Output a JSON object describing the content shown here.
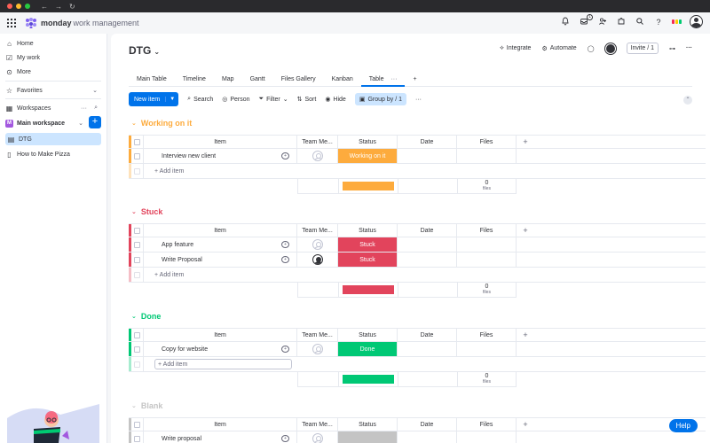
{
  "app": {
    "brand": "monday",
    "brand_sub": "work management",
    "notif_badge": "1"
  },
  "sidebar": {
    "home": "Home",
    "my_work": "My work",
    "more": "More",
    "favorites": "Favorites",
    "workspaces": "Workspaces",
    "workspace_badge": "M",
    "workspace_name": "Main workspace",
    "boards": [
      "DTG",
      "How to Make Pizza"
    ]
  },
  "board": {
    "title": "DTG",
    "integrate": "Integrate",
    "automate": "Automate",
    "invite": "Invite / 1",
    "tabs": [
      "Main Table",
      "Timeline",
      "Map",
      "Gantt",
      "Files Gallery",
      "Kanban",
      "Table"
    ]
  },
  "toolbar": {
    "new_item": "New item",
    "search": "Search",
    "person": "Person",
    "filter": "Filter",
    "sort": "Sort",
    "hide": "Hide",
    "group_by": "Group by / 1"
  },
  "columns": {
    "item": "Item",
    "team": "Team Me...",
    "status": "Status",
    "date": "Date",
    "files": "Files"
  },
  "add_item": "+ Add item",
  "files_label": "files",
  "colors": {
    "working": "#fdab3d",
    "stuck": "#e2445c",
    "done": "#00c875",
    "blank": "#c4c4c4",
    "accent": "#0073ea"
  },
  "groups": [
    {
      "title": "Working on it",
      "color": "#fdab3d",
      "files_count": "0",
      "summary_color": "#fdab3d",
      "rows": [
        {
          "item": "Interview new client",
          "status": "Working on it",
          "status_color": "#fdab3d",
          "assigned": false
        }
      ]
    },
    {
      "title": "Stuck",
      "color": "#e2445c",
      "files_count": "0",
      "summary_color": "#e2445c",
      "rows": [
        {
          "item": "App feature",
          "status": "Stuck",
          "status_color": "#e2445c",
          "assigned": false
        },
        {
          "item": "Write Proposal",
          "status": "Stuck",
          "status_color": "#e2445c",
          "assigned": true
        }
      ]
    },
    {
      "title": "Done",
      "color": "#00c875",
      "files_count": "0",
      "summary_color": "#00c875",
      "rows": [
        {
          "item": "Copy for website",
          "status": "Done",
          "status_color": "#00c875",
          "assigned": false
        }
      ]
    },
    {
      "title": "Blank",
      "color": "#c4c4c4",
      "rows": [
        {
          "item": "Write proposal",
          "status": "",
          "status_color": "#c4c4c4",
          "assigned": false
        }
      ]
    }
  ],
  "help": "Help"
}
